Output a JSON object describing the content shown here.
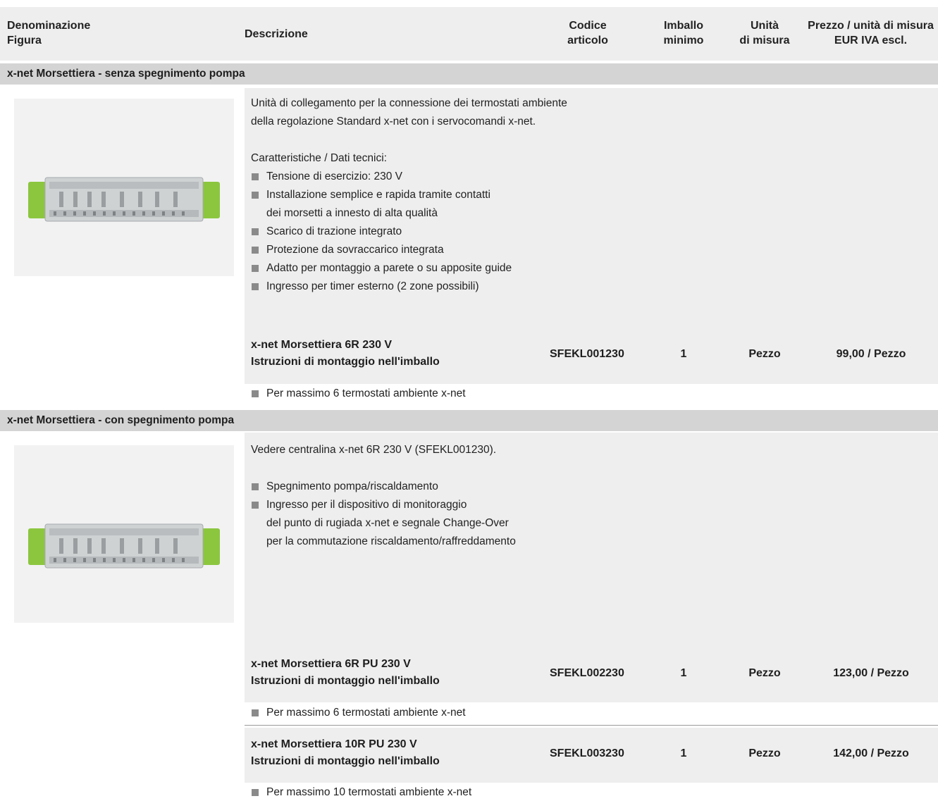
{
  "header": {
    "col_figure": [
      "Denominazione",
      "Figura"
    ],
    "col_description": "Descrizione",
    "col_code": [
      "Codice",
      "articolo"
    ],
    "col_packaging": [
      "Imballo",
      "minimo"
    ],
    "col_unit": [
      "Unità",
      "di misura"
    ],
    "col_price": [
      "Prezzo / unità di misura",
      "EUR IVA escl."
    ]
  },
  "sections": [
    {
      "title": "x-net Morsettiera - senza spegnimento pompa",
      "image_icon": "terminal-strip-image",
      "intro": [
        "Unità di collegamento per la connessione dei termostati ambiente",
        "della regolazione Standard x-net con i servocomandi x-net."
      ],
      "features_title": "Caratteristiche / Dati tecnici:",
      "features": [
        [
          "Tensione di esercizio: 230 V"
        ],
        [
          "Installazione semplice e rapida tramite contatti",
          "dei morsetti a innesto di alta qualità"
        ],
        [
          "Scarico di trazione integrato"
        ],
        [
          "Protezione da sovraccarico integrata"
        ],
        [
          "Adatto per montaggio a parete o su apposite guide"
        ],
        [
          "Ingresso per timer esterno (2 zone possibili)"
        ]
      ],
      "products": [
        {
          "name": "x-net Morsettiera 6R 230 V",
          "subtitle": "Istruzioni di montaggio nell'imballo",
          "code": "SFEKL001230",
          "min_pack": "1",
          "unit": "Pezzo",
          "price": "99,00 / Pezzo",
          "note": "Per massimo 6 termostati ambiente x-net"
        }
      ]
    },
    {
      "title": "x-net Morsettiera - con spegnimento pompa",
      "image_icon": "terminal-strip-image",
      "intro": [
        "Vedere centralina x-net 6R 230 V (SFEKL001230)."
      ],
      "features": [
        [
          "Spegnimento pompa/riscaldamento"
        ],
        [
          "Ingresso per il dispositivo di monitoraggio",
          "del punto di rugiada x-net e segnale Change-Over",
          "per la commutazione riscaldamento/raffreddamento"
        ]
      ],
      "products": [
        {
          "name": "x-net Morsettiera 6R PU 230 V",
          "subtitle": "Istruzioni di montaggio nell'imballo",
          "code": "SFEKL002230",
          "min_pack": "1",
          "unit": "Pezzo",
          "price": "123,00 / Pezzo",
          "note": "Per massimo 6 termostati ambiente x-net"
        },
        {
          "name": "x-net Morsettiera 10R PU 230 V",
          "subtitle": "Istruzioni di montaggio nell'imballo",
          "code": "SFEKL003230",
          "min_pack": "1",
          "unit": "Pezzo",
          "price": "142,00 / Pezzo",
          "note": "Per massimo 10 termostati ambiente x-net"
        }
      ]
    }
  ],
  "colors": {
    "header_bg": "#eeeeee",
    "section_bar": "#d4d4d4",
    "panel_bg": "#eeeeee",
    "bullet": "#8a8a8a",
    "device_green": "#8cc63f"
  }
}
